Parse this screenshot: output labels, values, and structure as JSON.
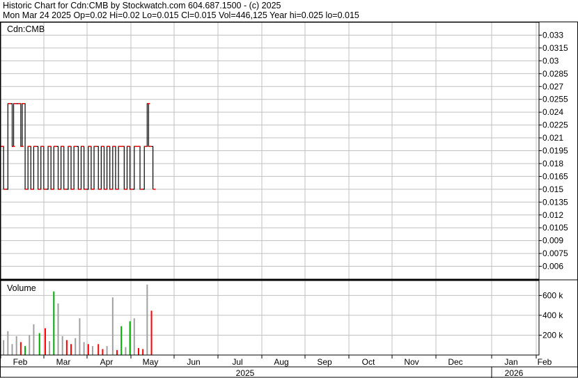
{
  "header": {
    "line1": "Historic Chart for Cdn:CMB by Stockwatch.com 604.687.1500 - (c) 2025",
    "line2": "Mon Mar 24 2025   Op=0.02   Hi=0.02   Lo=0.015   Cl=0.015   Vol=446,125   Year hi=0.025   lo=0.015"
  },
  "colors": {
    "grid": "#c0c0c0",
    "frame": "#000000",
    "price": "#000000",
    "close_mark": "#ff0000",
    "vol_up": "#00aa00",
    "vol_down": "#ff0000",
    "vol_flat": "#a0a0a0"
  },
  "chart_data": [
    {
      "type": "line",
      "title": "Cdn:CMB",
      "ylim": [
        0.0045,
        0.0345
      ],
      "y_ticks": [
        "0.033",
        "0.0315",
        "0.03",
        "0.0285",
        "0.027",
        "0.0255",
        "0.024",
        "0.0225",
        "0.021",
        "0.0195",
        "0.018",
        "0.0165",
        "0.015",
        "0.0135",
        "0.012",
        "0.0105",
        "0.009",
        "0.0075",
        "0.006"
      ],
      "x_months": [
        "Feb",
        "Mar",
        "Apr",
        "May",
        "Jun",
        "Jul",
        "Aug",
        "Sep",
        "Oct",
        "Nov",
        "Dec",
        "Jan",
        "Feb"
      ],
      "x_years": [
        "2025",
        "2026"
      ],
      "series": [
        {
          "day": 0,
          "close": 0.02
        },
        {
          "day": 2,
          "close": 0.015
        },
        {
          "day": 5,
          "close": 0.025
        },
        {
          "day": 8,
          "close": 0.02
        },
        {
          "day": 9,
          "close": 0.025
        },
        {
          "day": 12,
          "close": 0.025
        },
        {
          "day": 14,
          "close": 0.02
        },
        {
          "day": 15,
          "close": 0.025
        },
        {
          "day": 17,
          "close": 0.015
        },
        {
          "day": 19,
          "close": 0.02
        },
        {
          "day": 21,
          "close": 0.015
        },
        {
          "day": 23,
          "close": 0.02
        },
        {
          "day": 26,
          "close": 0.015
        },
        {
          "day": 28,
          "close": 0.02
        },
        {
          "day": 30,
          "close": 0.015
        },
        {
          "day": 33,
          "close": 0.02
        },
        {
          "day": 35,
          "close": 0.015
        },
        {
          "day": 37,
          "close": 0.02
        },
        {
          "day": 40,
          "close": 0.015
        },
        {
          "day": 42,
          "close": 0.02
        },
        {
          "day": 44,
          "close": 0.015
        },
        {
          "day": 47,
          "close": 0.02
        },
        {
          "day": 49,
          "close": 0.015
        },
        {
          "day": 51,
          "close": 0.02
        },
        {
          "day": 54,
          "close": 0.015
        },
        {
          "day": 56,
          "close": 0.02
        },
        {
          "day": 58,
          "close": 0.015
        },
        {
          "day": 61,
          "close": 0.02
        },
        {
          "day": 63,
          "close": 0.015
        },
        {
          "day": 65,
          "close": 0.02
        },
        {
          "day": 68,
          "close": 0.015
        },
        {
          "day": 70,
          "close": 0.02
        },
        {
          "day": 72,
          "close": 0.015
        },
        {
          "day": 74,
          "close": 0.02
        },
        {
          "day": 76,
          "close": 0.015
        },
        {
          "day": 78,
          "close": 0.02
        },
        {
          "day": 80,
          "close": 0.015
        },
        {
          "day": 82,
          "close": 0.02
        },
        {
          "day": 84,
          "close": 0.02
        },
        {
          "day": 86,
          "close": 0.015
        },
        {
          "day": 88,
          "close": 0.02
        },
        {
          "day": 90,
          "close": 0.015
        },
        {
          "day": 93,
          "close": 0.02
        },
        {
          "day": 95,
          "close": 0.02
        },
        {
          "day": 97,
          "close": 0.015
        },
        {
          "day": 100,
          "close": 0.02
        },
        {
          "day": 102,
          "close": 0.025
        },
        {
          "day": 103,
          "close": 0.02
        },
        {
          "day": 106,
          "close": 0.015
        }
      ]
    },
    {
      "type": "bar",
      "title": "Volume",
      "ylim": [
        0,
        750000
      ],
      "y_ticks": [
        "600 k",
        "400 k",
        "200 k"
      ],
      "y_tick_values": [
        600000,
        400000,
        200000
      ],
      "series": [
        {
          "day": 2,
          "volume": 150000,
          "dir": "flat"
        },
        {
          "day": 5,
          "volume": 240000,
          "dir": "flat"
        },
        {
          "day": 8,
          "volume": 110000,
          "dir": "flat"
        },
        {
          "day": 11,
          "volume": 190000,
          "dir": "flat"
        },
        {
          "day": 14,
          "volume": 130000,
          "dir": "down"
        },
        {
          "day": 17,
          "volume": 90000,
          "dir": "up"
        },
        {
          "day": 20,
          "volume": 200000,
          "dir": "flat"
        },
        {
          "day": 23,
          "volume": 310000,
          "dir": "flat"
        },
        {
          "day": 27,
          "volume": 220000,
          "dir": "up"
        },
        {
          "day": 31,
          "volume": 270000,
          "dir": "down"
        },
        {
          "day": 34,
          "volume": 140000,
          "dir": "flat"
        },
        {
          "day": 37,
          "volume": 640000,
          "dir": "up"
        },
        {
          "day": 40,
          "volume": 520000,
          "dir": "flat"
        },
        {
          "day": 43,
          "volume": 190000,
          "dir": "flat"
        },
        {
          "day": 46,
          "volume": 150000,
          "dir": "down"
        },
        {
          "day": 49,
          "volume": 110000,
          "dir": "down"
        },
        {
          "day": 52,
          "volume": 170000,
          "dir": "flat"
        },
        {
          "day": 55,
          "volume": 370000,
          "dir": "flat"
        },
        {
          "day": 58,
          "volume": 130000,
          "dir": "flat"
        },
        {
          "day": 61,
          "volume": 110000,
          "dir": "down"
        },
        {
          "day": 64,
          "volume": 90000,
          "dir": "flat"
        },
        {
          "day": 68,
          "volume": 110000,
          "dir": "down"
        },
        {
          "day": 71,
          "volume": 60000,
          "dir": "down"
        },
        {
          "day": 74,
          "volume": 90000,
          "dir": "flat"
        },
        {
          "day": 78,
          "volume": 580000,
          "dir": "flat"
        },
        {
          "day": 81,
          "volume": 50000,
          "dir": "down"
        },
        {
          "day": 84,
          "volume": 290000,
          "dir": "up"
        },
        {
          "day": 87,
          "volume": 80000,
          "dir": "flat"
        },
        {
          "day": 90,
          "volume": 340000,
          "dir": "up"
        },
        {
          "day": 93,
          "volume": 370000,
          "dir": "flat"
        },
        {
          "day": 96,
          "volume": 70000,
          "dir": "down"
        },
        {
          "day": 99,
          "volume": 60000,
          "dir": "down"
        },
        {
          "day": 102,
          "volume": 710000,
          "dir": "flat"
        },
        {
          "day": 105,
          "volume": 446125,
          "dir": "down"
        }
      ]
    }
  ]
}
